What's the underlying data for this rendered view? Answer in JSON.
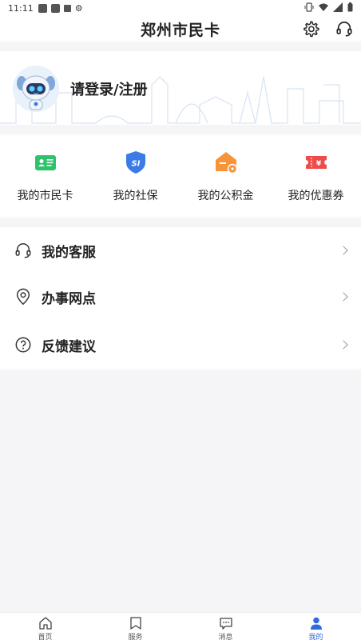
{
  "status_bar": {
    "time": "11:11"
  },
  "header": {
    "title": "郑州市民卡"
  },
  "profile": {
    "login_text": "请登录/注册"
  },
  "shortcuts": [
    {
      "label": "我的市民卡",
      "icon": "id-card-icon",
      "color": "#2ec26b"
    },
    {
      "label": "我的社保",
      "icon": "social-security-shield-icon",
      "color": "#3b7be8"
    },
    {
      "label": "我的公积金",
      "icon": "housing-fund-icon",
      "color": "#f7943a"
    },
    {
      "label": "我的优惠券",
      "icon": "coupon-icon",
      "color": "#f04b4b"
    }
  ],
  "menu": [
    {
      "label": "我的客服",
      "icon": "headset-icon"
    },
    {
      "label": "办事网点",
      "icon": "location-pin-icon"
    },
    {
      "label": "反馈建议",
      "icon": "question-circle-icon"
    }
  ],
  "tabs": [
    {
      "label": "首页",
      "icon": "home-icon",
      "active": false
    },
    {
      "label": "服务",
      "icon": "service-bookmark-icon",
      "active": false
    },
    {
      "label": "消息",
      "icon": "message-icon",
      "active": false
    },
    {
      "label": "我的",
      "icon": "user-icon",
      "active": true
    }
  ],
  "colors": {
    "accent": "#2f6bd9",
    "background": "#f5f5f7"
  }
}
